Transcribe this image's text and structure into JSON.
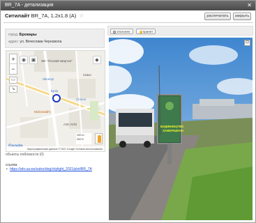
{
  "window": {
    "title": "BR_7A - детализация",
    "close_symbol": "✕"
  },
  "header": {
    "type": "Ситилайт",
    "code": "BR_7A,",
    "size": "1.2x1.8",
    "side": "(A)",
    "star": "☆",
    "print_label": "распечатать",
    "close_label": "закрыть"
  },
  "info": {
    "city_label": "город:",
    "city": "Бровары",
    "address_label": "адрес:",
    "address": "ул. Вячеслава Черновола"
  },
  "map": {
    "labels": {
      "complex": "ЖК \"Лісовий квартал\"",
      "building2": "Сімко",
      "skrotnyi": "Skrotnyi",
      "butyk": "Бутік",
      "silpo": "Сільпо",
      "mcdonalds": "McDonald's",
      "azs": "АЗС КЛО",
      "scale100": "100 m",
      "scale200": "200 ft"
    },
    "logo": "Google",
    "footer": "Картографические данные © 2021 Google   Условия использования",
    "zoom_in": "+",
    "zoom_out": "−"
  },
  "objects_nearby": "объекты поблизости (0)",
  "links": {
    "title": "ссылка",
    "bullet": "•",
    "url": "https://ahr.ua.ws/sales/dog/citylight_2021/plot/BR_7A"
  },
  "photo_tabs": {
    "declined": "отклонен",
    "accepted": "принят"
  },
  "billboard": {
    "line1": "БУДІВНИЦТВО",
    "line2": "ЗАВЕРШЕНО"
  },
  "expand_symbol": "⊡"
}
